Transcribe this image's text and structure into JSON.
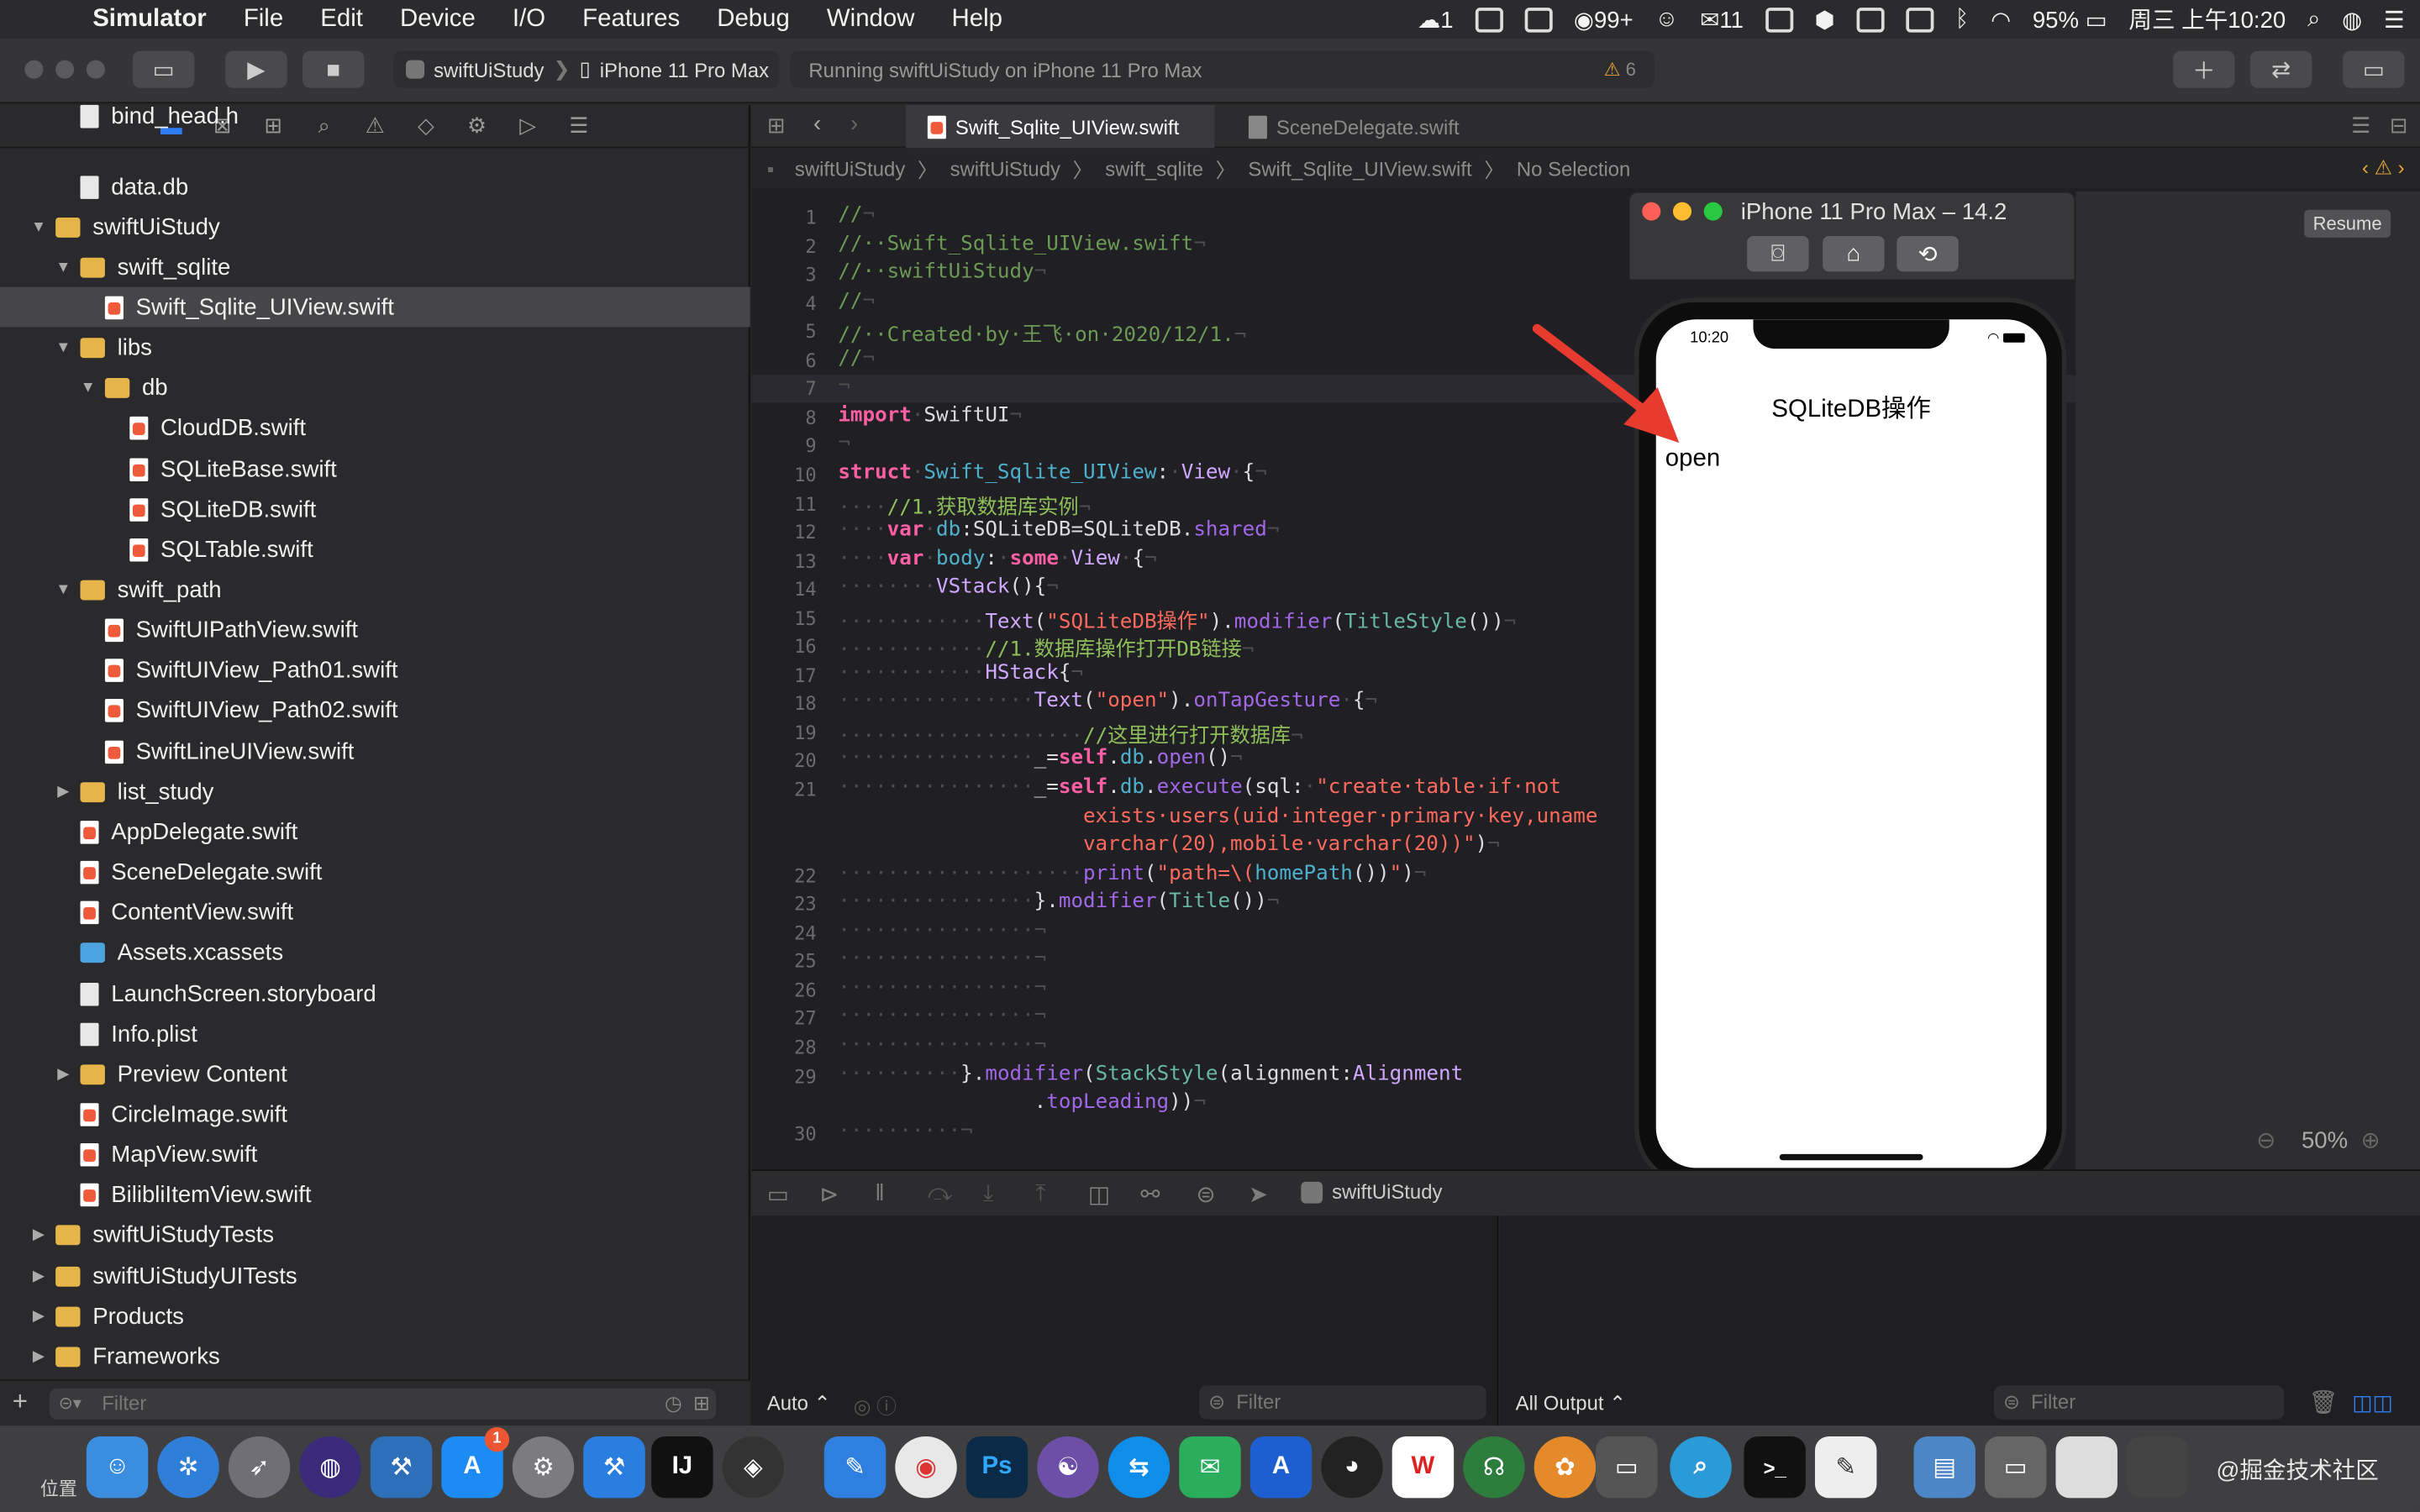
{
  "menubar": {
    "app": "Simulator",
    "items": [
      "File",
      "Edit",
      "Device",
      "I/O",
      "Features",
      "Debug",
      "Window",
      "Help"
    ],
    "right": {
      "badge1": "1",
      "badge2": "99+",
      "badge3": "11",
      "battery": "95%",
      "datetime": "周三 上午10:20"
    }
  },
  "toolbar": {
    "scheme": "swiftUiStudy",
    "device": "iPhone 11 Pro Max",
    "status": "Running swiftUiStudy on iPhone 11 Pro Max",
    "warnings": "6"
  },
  "navigator": {
    "rows": [
      {
        "label": "bind_head.h",
        "indent": 2,
        "kind": "wfile",
        "tri": ""
      },
      {
        "label": "data.db",
        "indent": 2,
        "kind": "wfile",
        "tri": ""
      },
      {
        "label": "swiftUiStudy",
        "indent": 1,
        "kind": "folder",
        "tri": "▼"
      },
      {
        "label": "swift_sqlite",
        "indent": 2,
        "kind": "folder",
        "tri": "▼"
      },
      {
        "label": "Swift_Sqlite_UIView.swift",
        "indent": 3,
        "kind": "sfile",
        "tri": "",
        "selected": true
      },
      {
        "label": "libs",
        "indent": 2,
        "kind": "folder",
        "tri": "▼"
      },
      {
        "label": "db",
        "indent": 3,
        "kind": "folder",
        "tri": "▼"
      },
      {
        "label": "CloudDB.swift",
        "indent": 4,
        "kind": "sfile",
        "tri": ""
      },
      {
        "label": "SQLiteBase.swift",
        "indent": 4,
        "kind": "sfile",
        "tri": ""
      },
      {
        "label": "SQLiteDB.swift",
        "indent": 4,
        "kind": "sfile",
        "tri": ""
      },
      {
        "label": "SQLTable.swift",
        "indent": 4,
        "kind": "sfile",
        "tri": ""
      },
      {
        "label": "swift_path",
        "indent": 2,
        "kind": "folder",
        "tri": "▼"
      },
      {
        "label": "SwiftUIPathView.swift",
        "indent": 3,
        "kind": "sfile",
        "tri": ""
      },
      {
        "label": "SwiftUIView_Path01.swift",
        "indent": 3,
        "kind": "sfile",
        "tri": ""
      },
      {
        "label": "SwiftUIView_Path02.swift",
        "indent": 3,
        "kind": "sfile",
        "tri": ""
      },
      {
        "label": "SwiftLineUIView.swift",
        "indent": 3,
        "kind": "sfile",
        "tri": ""
      },
      {
        "label": "list_study",
        "indent": 2,
        "kind": "folder",
        "tri": "▶"
      },
      {
        "label": "AppDelegate.swift",
        "indent": 2,
        "kind": "sfile",
        "tri": ""
      },
      {
        "label": "SceneDelegate.swift",
        "indent": 2,
        "kind": "sfile",
        "tri": ""
      },
      {
        "label": "ContentView.swift",
        "indent": 2,
        "kind": "sfile",
        "tri": ""
      },
      {
        "label": "Assets.xcassets",
        "indent": 2,
        "kind": "assets",
        "tri": ""
      },
      {
        "label": "LaunchScreen.storyboard",
        "indent": 2,
        "kind": "wfile",
        "tri": ""
      },
      {
        "label": "Info.plist",
        "indent": 2,
        "kind": "wfile",
        "tri": ""
      },
      {
        "label": "Preview Content",
        "indent": 2,
        "kind": "folder",
        "tri": "▶"
      },
      {
        "label": "CircleImage.swift",
        "indent": 2,
        "kind": "sfile",
        "tri": ""
      },
      {
        "label": "MapView.swift",
        "indent": 2,
        "kind": "sfile",
        "tri": ""
      },
      {
        "label": "BilibliItemView.swift",
        "indent": 2,
        "kind": "sfile",
        "tri": ""
      },
      {
        "label": "swiftUiStudyTests",
        "indent": 1,
        "kind": "folder",
        "tri": "▶"
      },
      {
        "label": "swiftUiStudyUITests",
        "indent": 1,
        "kind": "folder",
        "tri": "▶"
      },
      {
        "label": "Products",
        "indent": 1,
        "kind": "folder",
        "tri": "▶"
      },
      {
        "label": "Frameworks",
        "indent": 1,
        "kind": "folder",
        "tri": "▶"
      }
    ],
    "filter_placeholder": "Filter"
  },
  "editor": {
    "tabs": [
      "Swift_Sqlite_UIView.swift",
      "SceneDelegate.swift"
    ],
    "jumpbar": [
      "swiftUiStudy",
      "swiftUiStudy",
      "swift_sqlite",
      "Swift_Sqlite_UIView.swift",
      "No Selection"
    ],
    "lines": [
      {
        "n": "1",
        "html": "<span class='cm'>//</span><span class='dot'>¬</span>"
      },
      {
        "n": "2",
        "html": "<span class='cm'>//··Swift_Sqlite_UIView.swift</span><span class='dot'>¬</span>"
      },
      {
        "n": "3",
        "html": "<span class='cm'>//··swiftUiStudy</span><span class='dot'>¬</span>"
      },
      {
        "n": "4",
        "html": "<span class='cm'>//</span><span class='dot'>¬</span>"
      },
      {
        "n": "5",
        "html": "<span class='cm'>//··Created·by·王飞·on·2020/12/1.</span><span class='dot'>¬</span>"
      },
      {
        "n": "6",
        "html": "<span class='cm'>//</span><span class='dot'>¬</span>"
      },
      {
        "n": "7",
        "html": "<span class='dot'>¬</span>"
      },
      {
        "n": "8",
        "html": "<span class='kw'>import</span><span class='dot'>·</span>SwiftUI<span class='dot'>¬</span>"
      },
      {
        "n": "9",
        "html": "<span class='dot'>¬</span>"
      },
      {
        "n": "10",
        "html": "<span class='kw'>struct</span><span class='dot'>·</span><span class='id'>Swift_Sqlite_UIView</span>:<span class='dot'>·</span><span class='ty'>View</span><span class='dot'>·</span>{<span class='dot'>¬</span>"
      },
      {
        "n": "11",
        "html": "<span class='dot'>····</span><span class='cmz'>//1.获取数据库实例</span><span class='dot'>¬</span>"
      },
      {
        "n": "12",
        "html": "<span class='dot'>····</span><span class='kw'>var</span><span class='dot'>·</span><span class='id'>db</span>:SQLiteDB=SQLiteDB.<span class='pr'>shared</span><span class='dot'>¬</span>"
      },
      {
        "n": "13",
        "html": "<span class='dot'>····</span><span class='kw'>var</span><span class='dot'>·</span><span class='id'>body</span>:<span class='dot'>·</span><span class='kw'>some</span><span class='dot'>·</span><span class='ty'>View</span><span class='dot'>·</span>{<span class='dot'>¬</span>"
      },
      {
        "n": "14",
        "html": "<span class='dot'>········</span><span class='ty'>VStack</span>(){<span class='dot'>¬</span>"
      },
      {
        "n": "15",
        "html": "<span class='dot'>············</span><span class='ty'>Text</span>(<span class='str'>\"SQLiteDB操作\"</span>).<span class='pr'>modifier</span>(<span class='fn'>TitleStyle</span>())<span class='dot'>¬</span>"
      },
      {
        "n": "16",
        "html": "<span class='dot'>············</span><span class='cmz'>//1.数据库操作打开DB链接</span><span class='dot'>¬</span>"
      },
      {
        "n": "17",
        "html": "<span class='dot'>············</span><span class='ty'>HStack</span>{<span class='dot'>¬</span>"
      },
      {
        "n": "18",
        "html": "<span class='dot'>················</span><span class='ty'>Text</span>(<span class='str'>\"open\"</span>).<span class='pr'>onTapGesture</span><span class='dot'>·</span>{<span class='dot'>¬</span>"
      },
      {
        "n": "19",
        "html": "<span class='dot'>····················</span><span class='cmz'>//这里进行打开数据库</span><span class='dot'>¬</span>"
      },
      {
        "n": "20",
        "html": "<span class='dot'>················</span>_=<span class='kw'>self</span>.<span class='id'>db</span>.<span class='pr'>open</span>()<span class='dot'>¬</span>"
      },
      {
        "n": "21",
        "html": "<span class='dot'>················</span>_=<span class='kw'>self</span>.<span class='id'>db</span>.<span class='pr'>execute</span>(sql:<span class='dot'>·</span><span class='str'>\"create·table·if·not</span>"
      },
      {
        "n": "",
        "html": "<span class='str'>                    exists·users(uid·integer·primary·key,uname</span>"
      },
      {
        "n": "",
        "html": "<span class='str'>                    varchar(20),mobile·varchar(20))\"</span>)<span class='dot'>¬</span>"
      },
      {
        "n": "22",
        "html": "<span class='dot'>····················</span><span class='pr'>print</span>(<span class='str'>\"path=\\(</span><span class='id'>homePath</span>())<span class='str'>\"</span>)<span class='dot'>¬</span>"
      },
      {
        "n": "23",
        "html": "<span class='dot'>················</span>}.<span class='pr'>modifier</span>(<span class='fn'>Title</span>())<span class='dot'>¬</span>"
      },
      {
        "n": "24",
        "html": "<span class='dot'>················¬</span>"
      },
      {
        "n": "25",
        "html": "<span class='dot'>················¬</span>"
      },
      {
        "n": "26",
        "html": "<span class='dot'>················¬</span>"
      },
      {
        "n": "27",
        "html": "<span class='dot'>················¬</span>"
      },
      {
        "n": "28",
        "html": "<span class='dot'>················¬</span>"
      },
      {
        "n": "29",
        "html": "<span class='dot'>··········</span>}.<span class='pr'>modifier</span>(<span class='fn'>StackStyle</span>(alignment:<span class='ty'>Alignment</span>"
      },
      {
        "n": "",
        "html": "<span class='dot'>                </span>.<span class='pr'>topLeading</span>))<span class='dot'>¬</span>"
      },
      {
        "n": "30",
        "html": "<span class='dot'>··········¬</span>"
      }
    ]
  },
  "debugbar": {
    "target": "swiftUiStudy"
  },
  "console": {
    "left_mode": "Auto ⌃",
    "left_filter": "Filter",
    "right_mode": "All Output ⌃",
    "right_filter": "Filter"
  },
  "simulator": {
    "title": "iPhone 11 Pro Max – 14.2",
    "resume": "Resume",
    "zoom": "50%",
    "app": {
      "time": "10:20",
      "title": "SQLiteDB操作",
      "open": "open"
    }
  },
  "dock": {
    "position_label": "位置",
    "watermark": "@掘金技术社区",
    "badge": "1"
  }
}
